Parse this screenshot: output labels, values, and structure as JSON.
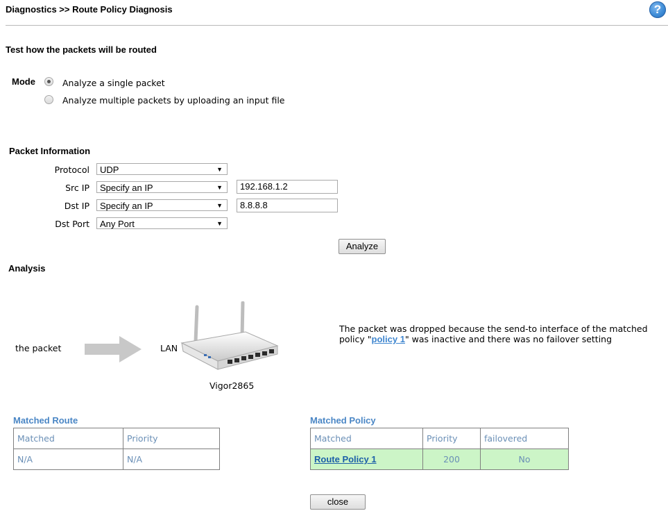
{
  "header": {
    "title": "Diagnostics >> Route Policy Diagnosis",
    "help_label": "?"
  },
  "intro": {
    "title": "Test how the packets will be routed"
  },
  "mode": {
    "label": "Mode",
    "options": [
      {
        "label": "Analyze a single packet",
        "selected": true
      },
      {
        "label": "Analyze multiple packets by uploading an input file",
        "selected": false
      }
    ]
  },
  "packet_info": {
    "title": "Packet Information",
    "protocol": {
      "label": "Protocol",
      "value": "UDP"
    },
    "src_ip": {
      "label": "Src IP",
      "mode": "Specify an IP",
      "value": "192.168.1.2"
    },
    "dst_ip": {
      "label": "Dst IP",
      "mode": "Specify an IP",
      "value": "8.8.8.8"
    },
    "dst_port": {
      "label": "Dst Port",
      "value": "Any Port"
    },
    "analyze_label": "Analyze"
  },
  "analysis": {
    "title": "Analysis",
    "packet_label": "the packet",
    "lan_label": "LAN",
    "device_name": "Vigor2865",
    "message_before": "The packet was dropped because the send-to interface of the matched policy \"",
    "message_policy": "policy 1",
    "message_after": "\" was inactive and there was no failover setting"
  },
  "matched_route": {
    "title": "Matched Route",
    "headers": [
      "Matched",
      "Priority"
    ],
    "row": [
      "N/A",
      "N/A"
    ]
  },
  "matched_policy": {
    "title": "Matched Policy",
    "headers": [
      "Matched",
      "Priority",
      "failovered"
    ],
    "row": {
      "matched": "Route Policy 1",
      "priority": "200",
      "failovered": "No"
    }
  },
  "close_label": "close",
  "colors": {
    "table_text": "#6a8fb6",
    "table_title": "#4a86c5",
    "highlight_row": "#ccf5c7",
    "link": "#1c5fa8"
  }
}
